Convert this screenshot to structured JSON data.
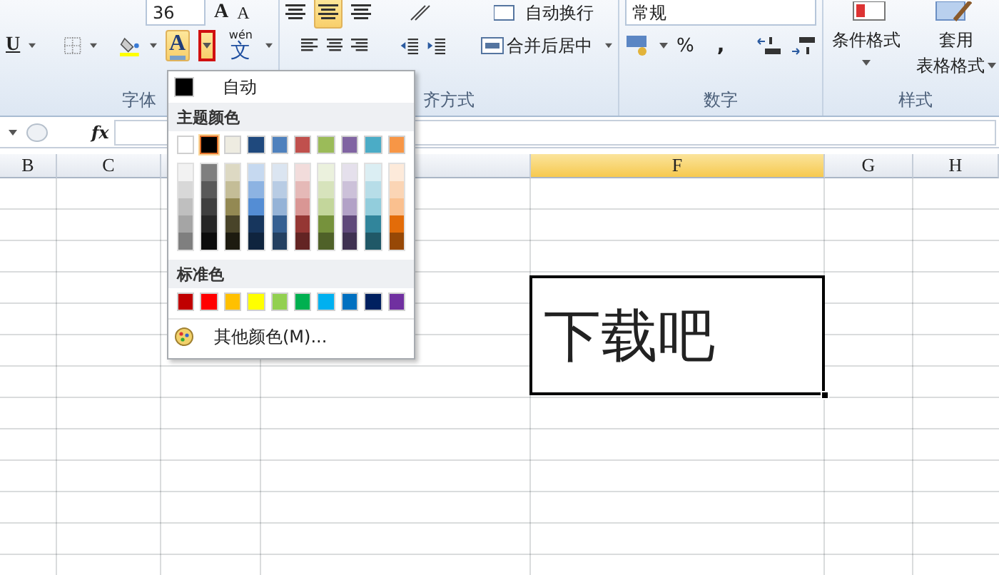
{
  "ribbon": {
    "font_size": "36",
    "grow_font": "A",
    "shrink_font": "A",
    "underline": "U",
    "font_color_letter": "A",
    "phonetic_top": "wén",
    "phonetic_char": "文",
    "wrap_text": "自动换行",
    "merge_center": "合并后居中",
    "number_format": "常规",
    "percent": "%",
    "comma": ",",
    "cond_format": "条件格式",
    "table_format_top": "套用",
    "table_format_bottom": "表格格式",
    "groups": [
      {
        "label": "字体"
      },
      {
        "label": "齐方式"
      },
      {
        "label": "数字"
      },
      {
        "label": "样式"
      }
    ]
  },
  "formula_bar": {
    "fx": "fx"
  },
  "columns": [
    {
      "label": "B",
      "selected": false
    },
    {
      "label": "C",
      "selected": false
    },
    {
      "selected": false
    },
    {
      "selected": false
    },
    {
      "label": "F",
      "selected": true
    },
    {
      "label": "G",
      "selected": false
    },
    {
      "label": "H",
      "selected": false
    }
  ],
  "cell": {
    "text": "下载吧"
  },
  "color_menu": {
    "auto": "自动",
    "theme_heading": "主题颜色",
    "theme": [
      {
        "color": "#ffffff",
        "selected": false,
        "shades": [
          {
            "color": "#f2f2f2"
          },
          {
            "color": "#d8d8d8"
          },
          {
            "color": "#bfbfbf"
          },
          {
            "color": "#a5a5a5"
          },
          {
            "color": "#7f7f7f"
          }
        ]
      },
      {
        "color": "#000000",
        "selected": true,
        "shades": [
          {
            "color": "#7f7f7f"
          },
          {
            "color": "#595959"
          },
          {
            "color": "#3f3f3f"
          },
          {
            "color": "#262626"
          },
          {
            "color": "#0c0c0c"
          }
        ]
      },
      {
        "color": "#eeece1",
        "selected": false,
        "shades": [
          {
            "color": "#ddd9c3"
          },
          {
            "color": "#c4bd97"
          },
          {
            "color": "#938953"
          },
          {
            "color": "#494429"
          },
          {
            "color": "#1d1b10"
          }
        ]
      },
      {
        "color": "#1f497d",
        "selected": false,
        "shades": [
          {
            "color": "#c6d9f0"
          },
          {
            "color": "#8db3e2"
          },
          {
            "color": "#548dd4"
          },
          {
            "color": "#17365d"
          },
          {
            "color": "#0f243e"
          }
        ]
      },
      {
        "color": "#4f81bd",
        "selected": false,
        "shades": [
          {
            "color": "#dbe5f1"
          },
          {
            "color": "#b8cce4"
          },
          {
            "color": "#95b3d7"
          },
          {
            "color": "#366092"
          },
          {
            "color": "#244061"
          }
        ]
      },
      {
        "color": "#c0504d",
        "selected": false,
        "shades": [
          {
            "color": "#f2dcdb"
          },
          {
            "color": "#e5b9b7"
          },
          {
            "color": "#d99694"
          },
          {
            "color": "#953734"
          },
          {
            "color": "#632423"
          }
        ]
      },
      {
        "color": "#9bbb59",
        "selected": false,
        "shades": [
          {
            "color": "#ebf1dd"
          },
          {
            "color": "#d7e3bc"
          },
          {
            "color": "#c3d69b"
          },
          {
            "color": "#76923c"
          },
          {
            "color": "#4f6128"
          }
        ]
      },
      {
        "color": "#8064a2",
        "selected": false,
        "shades": [
          {
            "color": "#e5e0ec"
          },
          {
            "color": "#ccc1d9"
          },
          {
            "color": "#b2a2c7"
          },
          {
            "color": "#5f497a"
          },
          {
            "color": "#3f3151"
          }
        ]
      },
      {
        "color": "#4bacc6",
        "selected": false,
        "shades": [
          {
            "color": "#dbeef3"
          },
          {
            "color": "#b7dde8"
          },
          {
            "color": "#92cddc"
          },
          {
            "color": "#31859b"
          },
          {
            "color": "#205867"
          }
        ]
      },
      {
        "color": "#f79646",
        "selected": false,
        "shades": [
          {
            "color": "#fdeada"
          },
          {
            "color": "#fbd5b5"
          },
          {
            "color": "#fac08f"
          },
          {
            "color": "#e36c09"
          },
          {
            "color": "#974806"
          }
        ]
      }
    ],
    "standard_heading": "标准色",
    "standard": [
      {
        "color": "#c00000"
      },
      {
        "color": "#ff0000"
      },
      {
        "color": "#ffc000"
      },
      {
        "color": "#ffff00"
      },
      {
        "color": "#92d050"
      },
      {
        "color": "#00b050"
      },
      {
        "color": "#00b0f0"
      },
      {
        "color": "#0070c0"
      },
      {
        "color": "#002060"
      },
      {
        "color": "#7030a0"
      }
    ],
    "more": "其他颜色(M)..."
  }
}
